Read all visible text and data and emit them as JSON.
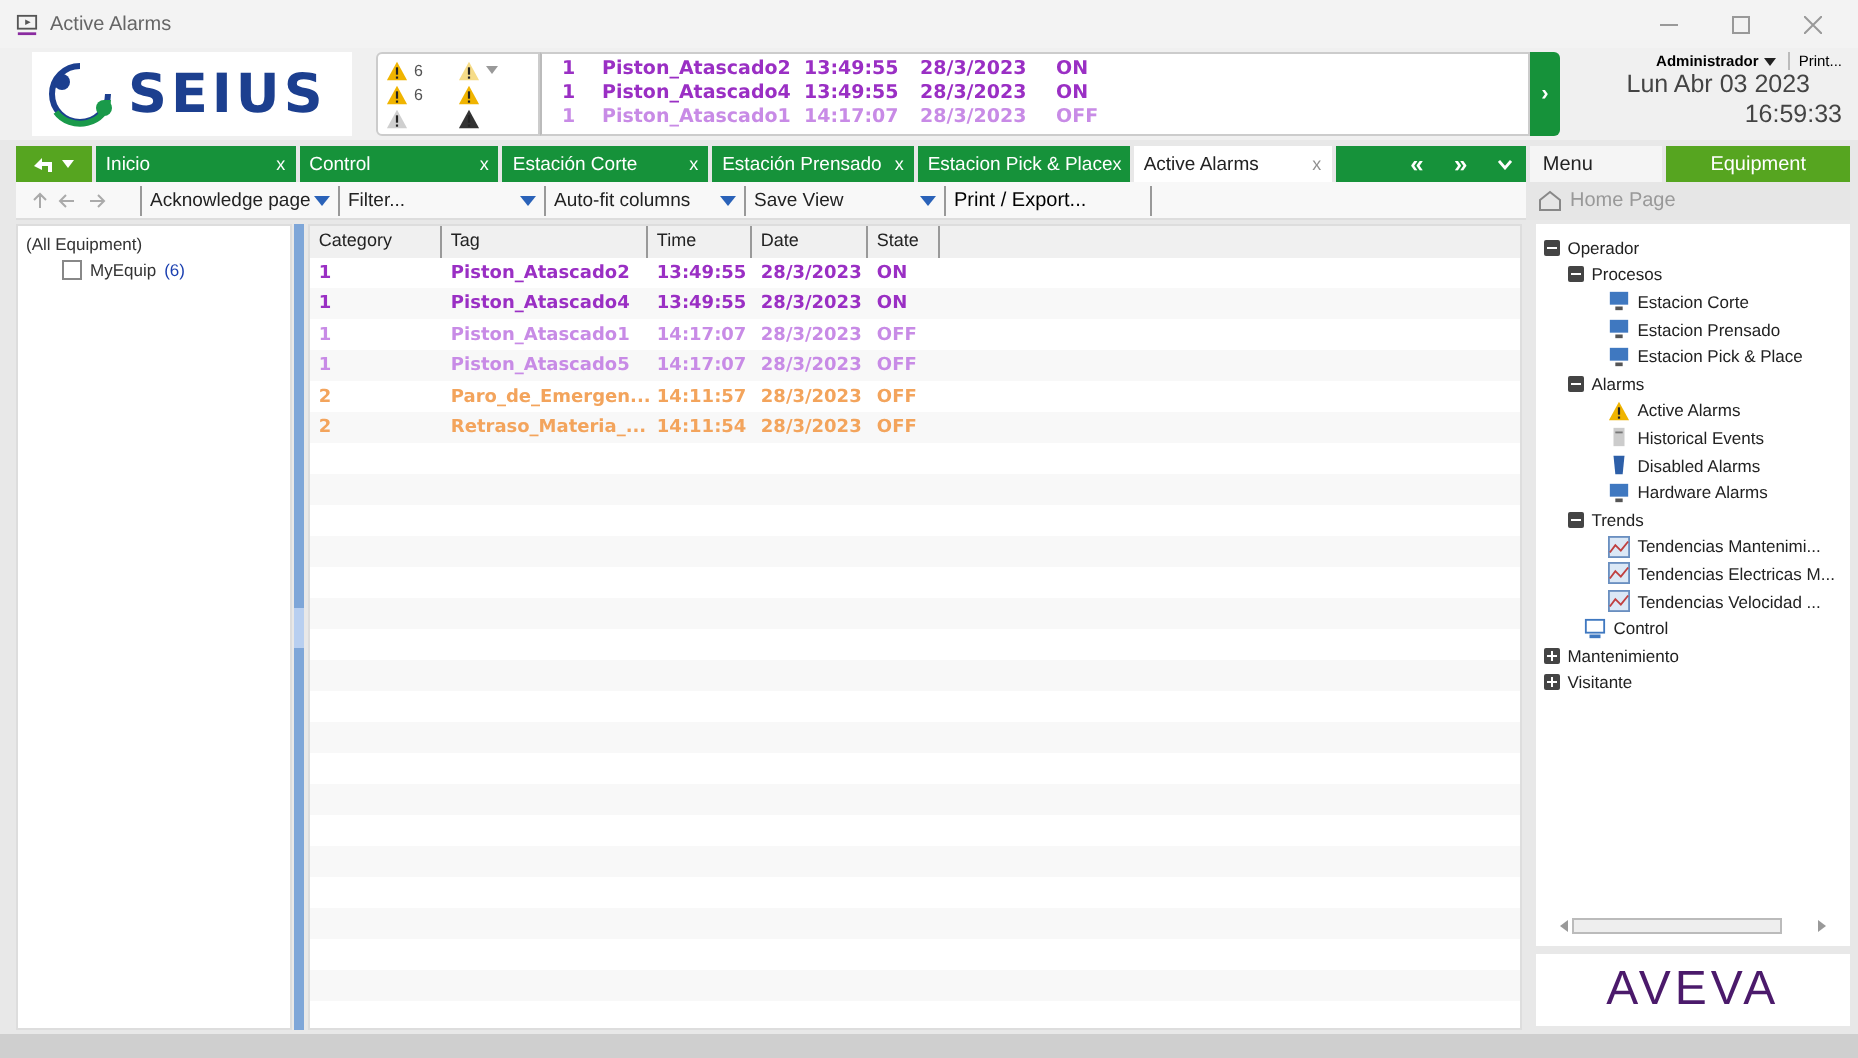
{
  "window": {
    "title": "Active Alarms"
  },
  "header": {
    "logo": "SEIUS",
    "summary": [
      {
        "kind": "active",
        "count": "6"
      },
      {
        "kind": "silenced"
      },
      {
        "kind": "unacked",
        "count": "6"
      },
      {
        "kind": "shelved"
      },
      {
        "kind": "disabled"
      },
      {
        "kind": "list"
      }
    ],
    "banner": [
      {
        "category": "1",
        "tag": "Piston_Atascado2",
        "time": "13:49:55",
        "date": "28/3/2023",
        "state": "ON",
        "color": "#9a2fc4"
      },
      {
        "category": "1",
        "tag": "Piston_Atascado4",
        "time": "13:49:55",
        "date": "28/3/2023",
        "state": "ON",
        "color": "#9a2fc4"
      },
      {
        "category": "1",
        "tag": "Piston_Atascado1",
        "time": "14:17:07",
        "date": "28/3/2023",
        "state": "OFF",
        "color": "#c88be6"
      }
    ],
    "expand_button": "›",
    "user": "Administrador",
    "print": "Print...",
    "date": "Lun Abr 03 2023",
    "time": "16:59:33"
  },
  "tabs": [
    {
      "label": "Inicio",
      "close": "x",
      "selected": false
    },
    {
      "label": "Control",
      "close": "x",
      "selected": false
    },
    {
      "label": "Estación  Corte",
      "close": "x",
      "selected": false
    },
    {
      "label": "Estación  Prensado",
      "close": "x",
      "selected": false
    },
    {
      "label": "Estacion Pick & Place",
      "close": "x",
      "selected": false
    },
    {
      "label": "Active Alarms",
      "close": "x",
      "selected": true
    }
  ],
  "tab_nav": [
    "«",
    "»"
  ],
  "side_tabs": [
    {
      "label": "Menu",
      "selected": false
    },
    {
      "label": "Equipment",
      "selected": true
    }
  ],
  "toolbar": {
    "items": [
      "Acknowledge page",
      "Filter...",
      "Auto-fit columns",
      "Save View"
    ],
    "print": "Print / Export..."
  },
  "home": "Home Page",
  "equipment_filter": {
    "root": "(All Equipment)",
    "items": [
      {
        "label": "MyEquip",
        "count": "(6)",
        "checked": false
      }
    ]
  },
  "table": {
    "columns": [
      "Category",
      "Tag",
      "Time",
      "Date",
      "State"
    ],
    "rows": [
      {
        "category": "1",
        "tag": "Piston_Atascado2",
        "time": "13:49:55",
        "date": "28/3/2023",
        "state": "ON",
        "color": "#9a2fc4"
      },
      {
        "category": "1",
        "tag": "Piston_Atascado4",
        "time": "13:49:55",
        "date": "28/3/2023",
        "state": "ON",
        "color": "#9a2fc4"
      },
      {
        "category": "1",
        "tag": "Piston_Atascado1",
        "time": "14:17:07",
        "date": "28/3/2023",
        "state": "OFF",
        "color": "#c88be6"
      },
      {
        "category": "1",
        "tag": "Piston_Atascado5",
        "time": "14:17:07",
        "date": "28/3/2023",
        "state": "OFF",
        "color": "#c88be6"
      },
      {
        "category": "2",
        "tag": "Paro_de_Emergen...",
        "time": "14:11:57",
        "date": "28/3/2023",
        "state": "OFF",
        "color": "#f3a45c"
      },
      {
        "category": "2",
        "tag": "Retraso_Materia_...",
        "time": "14:11:54",
        "date": "28/3/2023",
        "state": "OFF",
        "color": "#f3a45c"
      }
    ]
  },
  "nav_tree": [
    {
      "label": "Operador",
      "expanded": true,
      "children": [
        {
          "label": "Procesos",
          "expanded": true,
          "children": [
            {
              "label": "Estacion Corte",
              "kind": "screen"
            },
            {
              "label": "Estacion Prensado",
              "kind": "screen"
            },
            {
              "label": "Estacion Pick & Place",
              "kind": "screen"
            }
          ]
        },
        {
          "label": "Alarms",
          "expanded": true,
          "children": [
            {
              "label": "Active Alarms",
              "kind": "warning"
            },
            {
              "label": "Historical Events",
              "kind": "document"
            },
            {
              "label": "Disabled Alarms",
              "kind": "bin"
            },
            {
              "label": "Hardware Alarms",
              "kind": "screen"
            }
          ]
        },
        {
          "label": "Trends",
          "expanded": true,
          "children": [
            {
              "label": "Tendencias Mantenimi...",
              "kind": "trend"
            },
            {
              "label": "Tendencias Electricas M...",
              "kind": "trend"
            },
            {
              "label": "Tendencias Velocidad ...",
              "kind": "trend"
            }
          ]
        },
        {
          "label": "Control",
          "kind": "control"
        }
      ]
    },
    {
      "label": "Mantenimiento",
      "expanded": false
    },
    {
      "label": "Visitante",
      "expanded": false
    }
  ],
  "brand": "AVEVA"
}
